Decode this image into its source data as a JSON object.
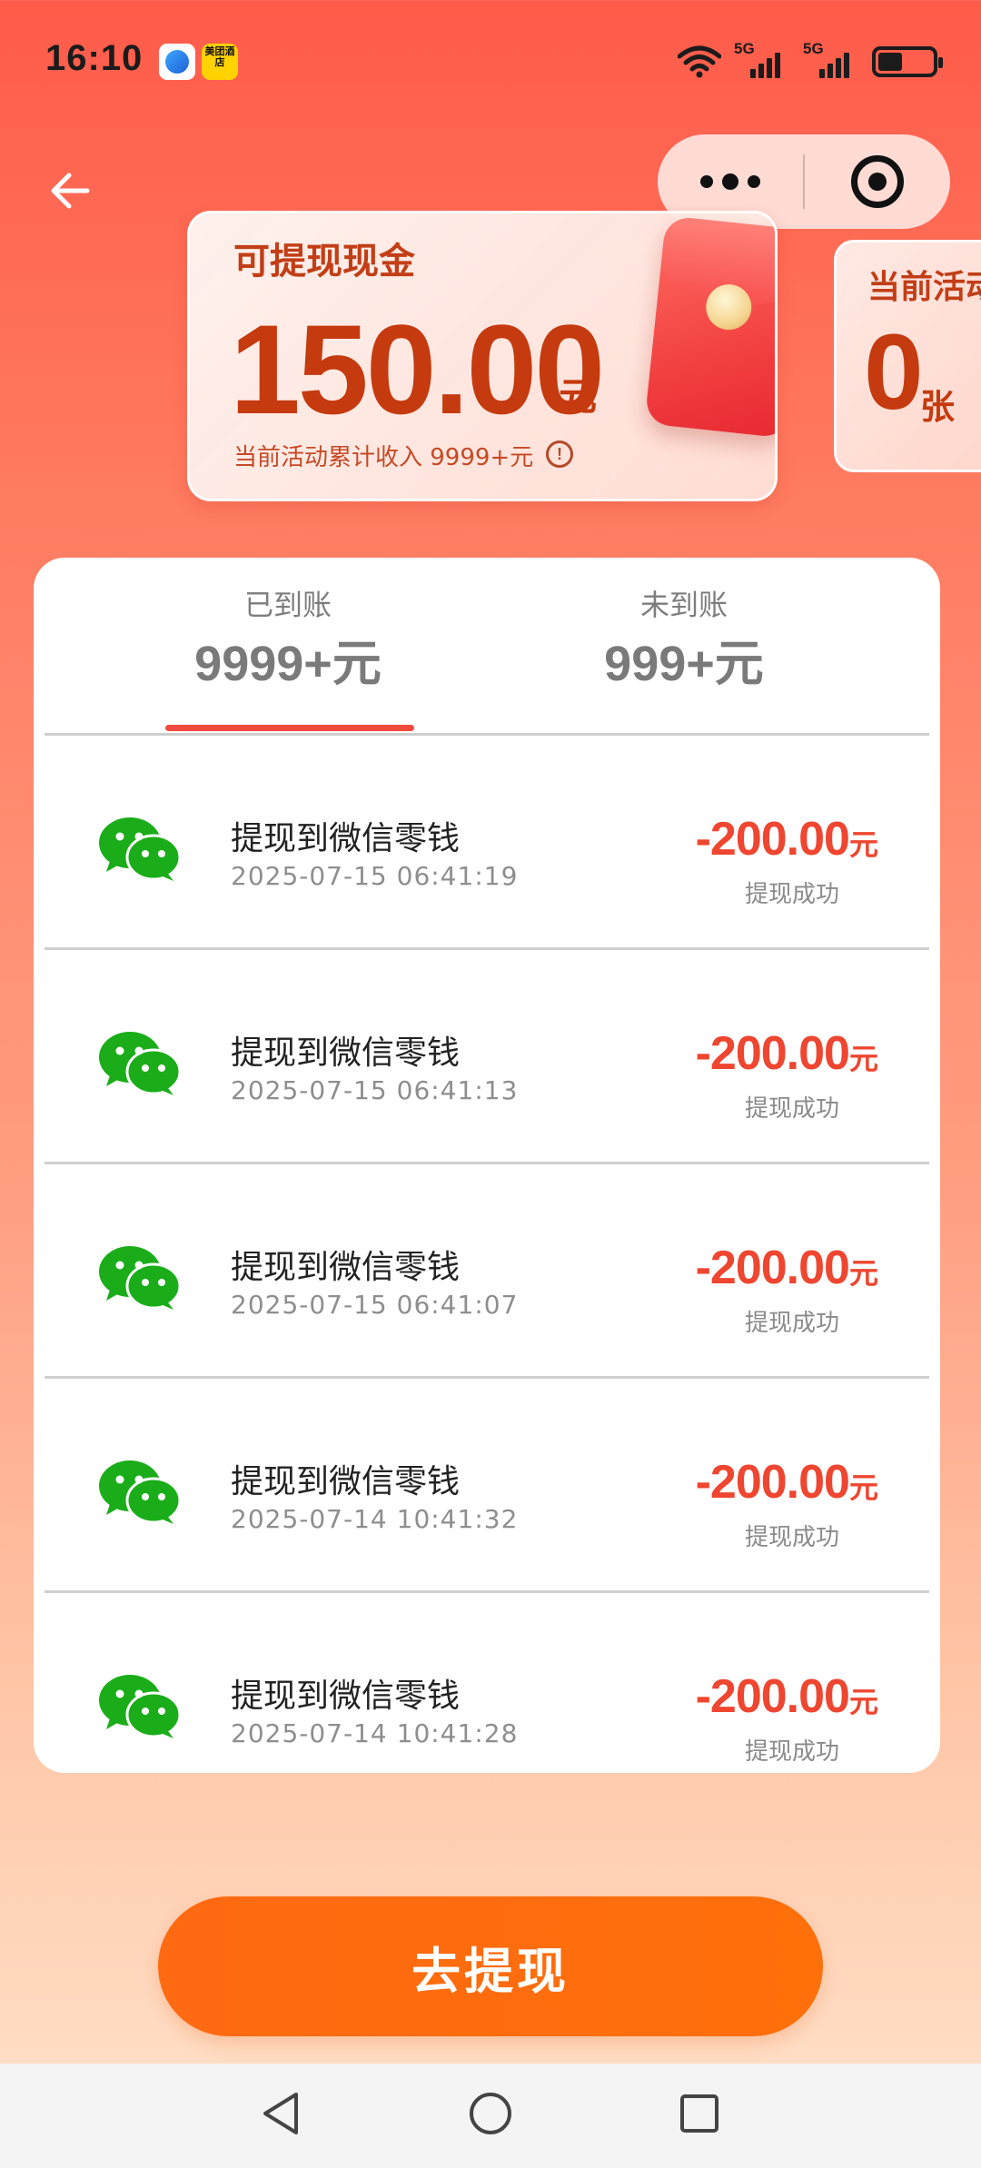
{
  "status_bar": {
    "time": "16:10",
    "app_icon_2_text": "美团酒店",
    "net1_label": "5G",
    "net2_label": "5G"
  },
  "capsule": {
    "more_icon": "more-dots-icon",
    "close_icon": "target-close-icon"
  },
  "cash_card": {
    "label": "可提现现金",
    "amount": "150.00",
    "unit": "元",
    "subtitle": "当前活动累计收入 9999+元",
    "info_icon": "!"
  },
  "side_card": {
    "label": "当前活动",
    "count": "0",
    "unit": "张"
  },
  "tabs": [
    {
      "label": "已到账",
      "value": "9999+元",
      "active": true
    },
    {
      "label": "未到账",
      "value": "999+元",
      "active": false
    }
  ],
  "records": [
    {
      "title": "提现到微信零钱",
      "time": "2025-07-15 06:41:19",
      "amount": "-200.00",
      "unit": "元",
      "status": "提现成功"
    },
    {
      "title": "提现到微信零钱",
      "time": "2025-07-15 06:41:13",
      "amount": "-200.00",
      "unit": "元",
      "status": "提现成功"
    },
    {
      "title": "提现到微信零钱",
      "time": "2025-07-15 06:41:07",
      "amount": "-200.00",
      "unit": "元",
      "status": "提现成功"
    },
    {
      "title": "提现到微信零钱",
      "time": "2025-07-14 10:41:32",
      "amount": "-200.00",
      "unit": "元",
      "status": "提现成功"
    },
    {
      "title": "提现到微信零钱",
      "time": "2025-07-14 10:41:28",
      "amount": "-200.00",
      "unit": "元",
      "status": "提现成功"
    }
  ],
  "cta": {
    "label": "去提现"
  },
  "colors": {
    "accent": "#ee4630",
    "cta": "#ff6a12",
    "brand_text": "#c53a0e",
    "wechat_green": "#1aad19"
  }
}
